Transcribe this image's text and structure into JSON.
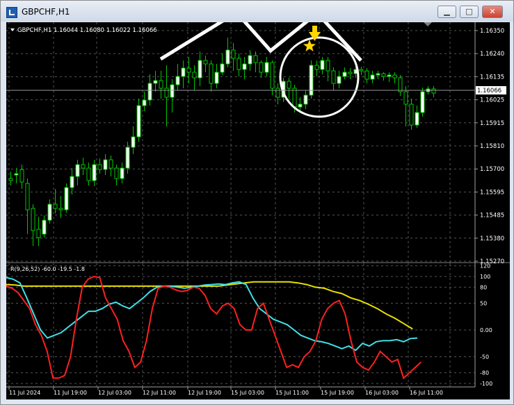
{
  "window": {
    "title": "GBPCHF,H1",
    "buttons": [
      "minimize",
      "maximize",
      "close"
    ]
  },
  "main_chart": {
    "symbol_info": "GBPCHF,H1  1.16044 1.16080 1.16022 1.16066",
    "price_axis": [
      "1.16350",
      "1.16240",
      "1.16135",
      "1.16025",
      "1.15915",
      "1.15810",
      "1.15700",
      "1.15595",
      "1.15485",
      "1.15380",
      "1.15270"
    ],
    "current_price": "1.16066",
    "colors": {
      "background": "#000000",
      "up_candle": "#ffffff",
      "down_candle": "#000000",
      "wick": "#00c800",
      "grid": "#606060"
    },
    "annotations": {
      "arrow_color": "#ffd700",
      "star_color": "#ffd700",
      "shape_color": "#ffffff"
    }
  },
  "indicator": {
    "label": "R(9,26,52) -60.0 -19.5 -1.8",
    "axis": [
      "120",
      "100",
      "80",
      "50",
      "0.00",
      "-50",
      "-80",
      "-100"
    ],
    "colors": {
      "fast": "#ff2020",
      "mid": "#40e0e8",
      "slow": "#e8e000"
    },
    "fast_series": [
      82,
      78,
      70,
      55,
      40,
      10,
      -10,
      -40,
      -90,
      -90,
      -85,
      -50,
      20,
      80,
      95,
      100,
      98,
      60,
      40,
      20,
      -20,
      -40,
      -70,
      -60,
      -20,
      40,
      78,
      82,
      80,
      75,
      72,
      74,
      80,
      78,
      65,
      40,
      30,
      45,
      50,
      40,
      10,
      0,
      0,
      40,
      50,
      20,
      -10,
      -40,
      -70,
      -65,
      -70,
      -50,
      -40,
      -20,
      20,
      40,
      50,
      55,
      30,
      -20,
      -60,
      -70,
      -75,
      -60,
      -40,
      -50,
      -60,
      -55,
      -90,
      -80,
      -70,
      -60
    ],
    "mid_series": [
      98,
      95,
      88,
      60,
      30,
      0,
      -15,
      -10,
      -5,
      5,
      15,
      25,
      35,
      35,
      40,
      48,
      52,
      45,
      40,
      50,
      60,
      72,
      80,
      82,
      82,
      80,
      78,
      80,
      82,
      84,
      85,
      86,
      85,
      88,
      90,
      85,
      60,
      40,
      30,
      20,
      15,
      10,
      0,
      -10,
      -15,
      -20,
      -22,
      -25,
      -30,
      -35,
      -30,
      -38,
      -25,
      -30,
      -22,
      -20,
      -20,
      -18,
      -22,
      -16,
      -15
    ],
    "slow_series": [
      85,
      84,
      82,
      82,
      82,
      82,
      82,
      82,
      82,
      82,
      82,
      82,
      82,
      82,
      82,
      82,
      82,
      82,
      82,
      82,
      82,
      82,
      82,
      82,
      82,
      84,
      86,
      88,
      90,
      90,
      90,
      90,
      90,
      88,
      85,
      80,
      78,
      72,
      68,
      60,
      55,
      48,
      40,
      30,
      22,
      12,
      2
    ],
    "time_axis": [
      "11 Jul 2024",
      "11 Jul 19:00",
      "12 Jul 03:00",
      "12 Jul 11:00",
      "12 Jul 19:00",
      "15 Jul 03:00",
      "15 Jul 11:00",
      "15 Jul 19:00",
      "16 Jul 03:00",
      "16 Jul 11:00"
    ]
  }
}
